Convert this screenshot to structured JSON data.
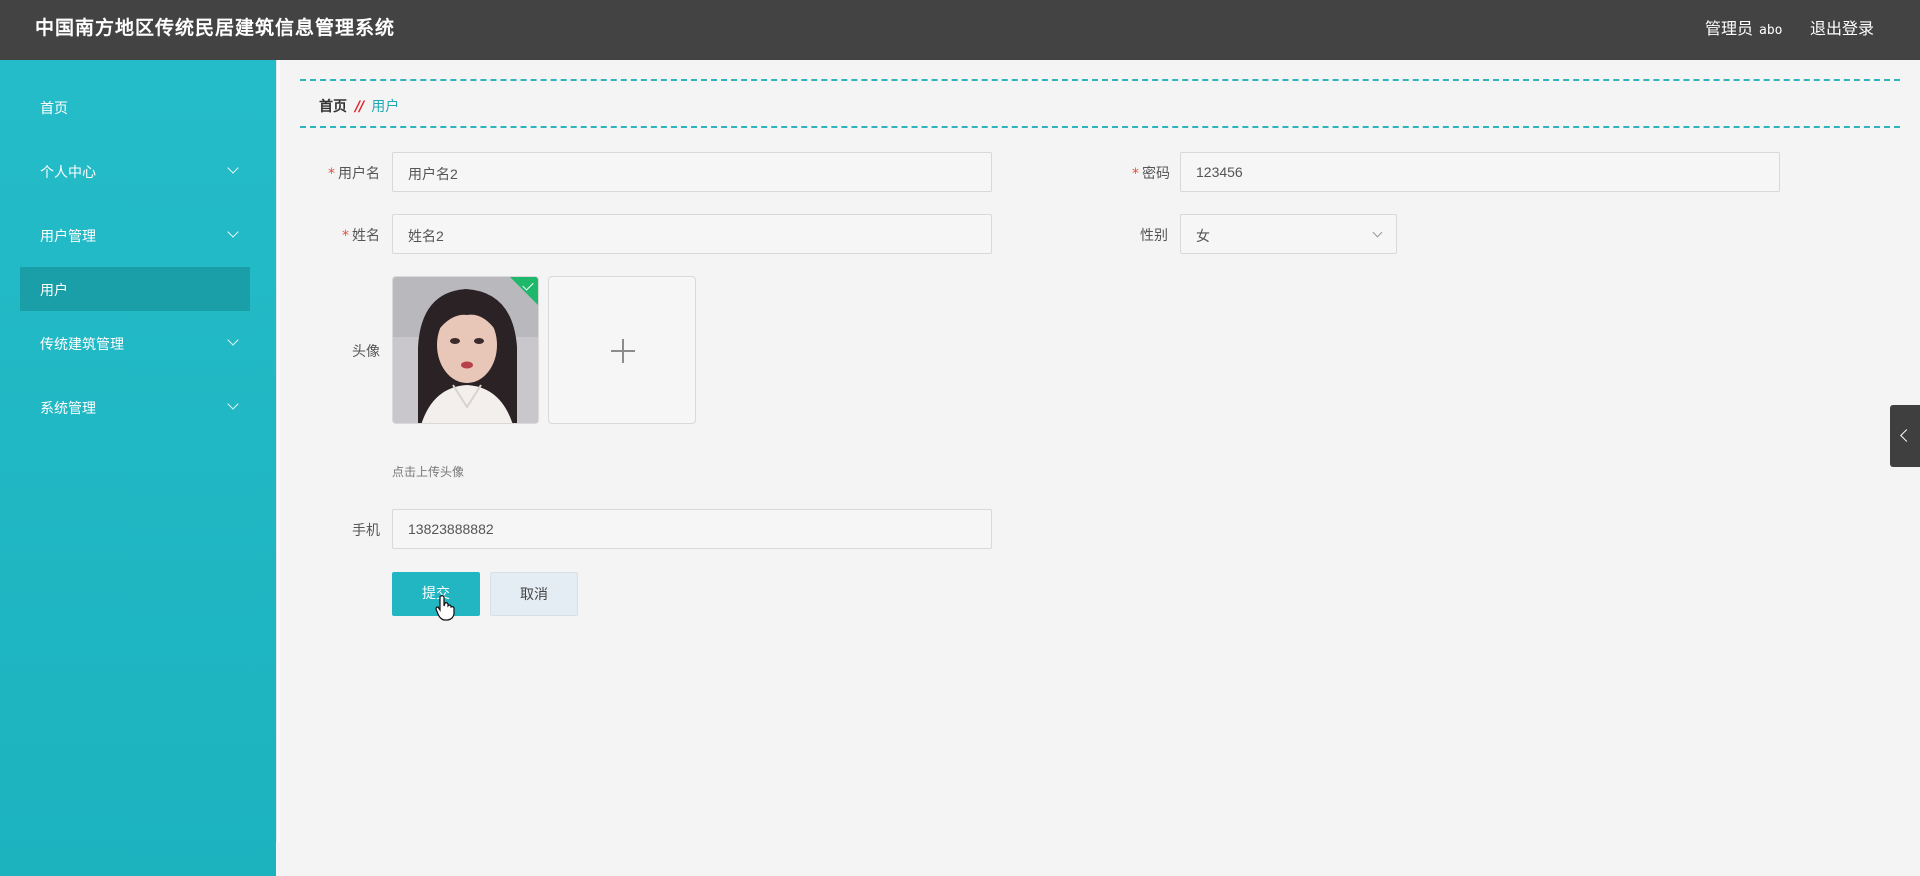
{
  "header": {
    "title": "中国南方地区传统民居建筑信息管理系统",
    "role": "管理员",
    "username": "abo",
    "logout": "退出登录"
  },
  "sidebar": {
    "items": [
      {
        "label": "首页",
        "expandable": false
      },
      {
        "label": "个人中心",
        "expandable": true
      },
      {
        "label": "用户管理",
        "expandable": true
      },
      {
        "label": "用户",
        "expandable": false,
        "active": true
      },
      {
        "label": "传统建筑管理",
        "expandable": true
      },
      {
        "label": "系统管理",
        "expandable": true
      }
    ]
  },
  "breadcrumb": {
    "home": "首页",
    "separator": "//",
    "current": "用户"
  },
  "form": {
    "username": {
      "label": "用户名",
      "required": true,
      "value": "用户名2"
    },
    "password": {
      "label": "密码",
      "required": true,
      "value": "123456"
    },
    "name": {
      "label": "姓名",
      "required": true,
      "value": "姓名2"
    },
    "gender": {
      "label": "性别",
      "value": "女"
    },
    "avatar": {
      "label": "头像",
      "hint": "点击上传头像",
      "uploaded": true
    },
    "phone": {
      "label": "手机",
      "value": "13823888882"
    }
  },
  "buttons": {
    "submit": "提交",
    "cancel": "取消"
  },
  "colors": {
    "accent": "#22b6c2",
    "sidebar": "#1cb3bf",
    "header": "#434343",
    "required": "#e74c3c",
    "breadcrumb_sep": "#e0262b"
  }
}
